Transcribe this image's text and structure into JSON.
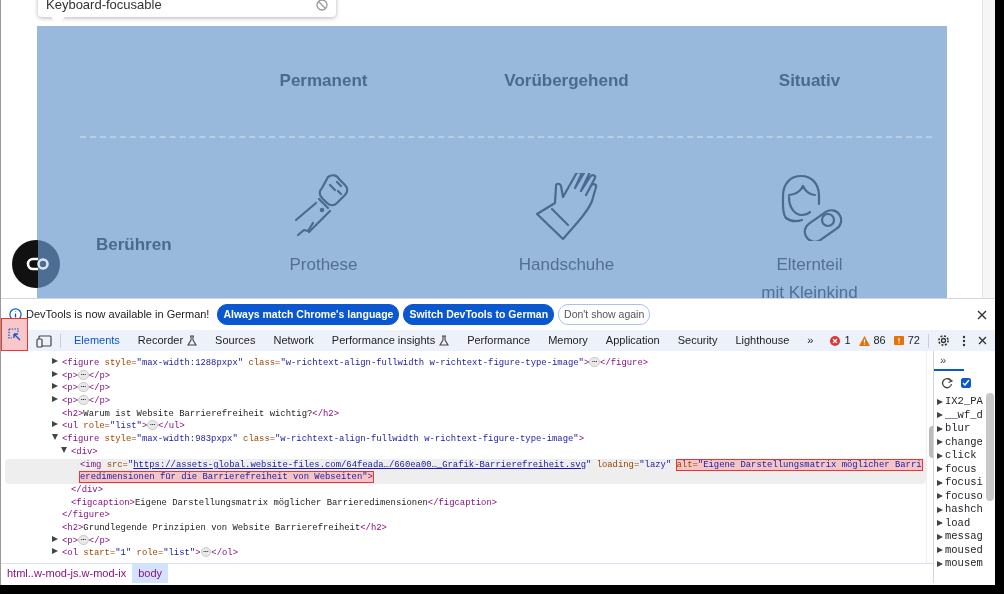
{
  "page": {
    "tooltip": {
      "text": "Keyboard-focusable"
    },
    "matrix": {
      "columns": [
        "Permanent",
        "Vorübergehend",
        "Situativ"
      ],
      "rows": [
        {
          "label": "Berühren",
          "cells": [
            {
              "kind": "prosthesis",
              "label": "Prothese"
            },
            {
              "kind": "glove",
              "label": "Handschuhe"
            },
            {
              "kind": "parent",
              "label": "Elternteil\nmit Kleinkind"
            }
          ]
        }
      ]
    }
  },
  "infobar": {
    "message": "DevTools is now available in German!",
    "buttons": [
      {
        "label": "Always match Chrome's language",
        "kind": "primary"
      },
      {
        "label": "Switch DevTools to German",
        "kind": "primary"
      },
      {
        "label": "Don't show again",
        "kind": "outline"
      }
    ]
  },
  "toolbar": {
    "inspect_selected": true,
    "tabs": [
      {
        "label": "Elements",
        "selected": true,
        "experimental": false
      },
      {
        "label": "Recorder",
        "selected": false,
        "experimental": true
      },
      {
        "label": "Sources",
        "selected": false,
        "experimental": false
      },
      {
        "label": "Network",
        "selected": false,
        "experimental": false
      },
      {
        "label": "Performance insights",
        "selected": false,
        "experimental": true
      },
      {
        "label": "Performance",
        "selected": false,
        "experimental": false
      },
      {
        "label": "Memory",
        "selected": false,
        "experimental": false
      },
      {
        "label": "Application",
        "selected": false,
        "experimental": false
      },
      {
        "label": "Security",
        "selected": false,
        "experimental": false
      },
      {
        "label": "Lighthouse",
        "selected": false,
        "experimental": false
      }
    ],
    "more": "»",
    "errors": "1",
    "warnings": "86",
    "issues": "72"
  },
  "elements": {
    "nodes": [
      {
        "expanded": false,
        "selected": false,
        "rows": [
          [
            {
              "kind": "tag",
              "t": "<figure"
            },
            {
              "kind": "attr",
              "t": " style="
            },
            {
              "kind": "val",
              "t": "\"max-width:1288pxpx\""
            },
            {
              "kind": "attr",
              "t": " class="
            },
            {
              "kind": "val",
              "t": "\"w-richtext-align-fullwidth w-richtext-figure-type-image\""
            },
            {
              "kind": "tag",
              "t": ">"
            },
            {
              "kind": "more",
              "t": "⋯"
            },
            {
              "kind": "tag",
              "t": "</figure>"
            }
          ]
        ]
      },
      {
        "expanded": false,
        "selected": false,
        "rows": [
          [
            {
              "kind": "tag",
              "t": "<p>"
            },
            {
              "kind": "more",
              "t": "⋯"
            },
            {
              "kind": "tag",
              "t": "</p>"
            }
          ]
        ]
      },
      {
        "expanded": false,
        "selected": false,
        "rows": [
          [
            {
              "kind": "tag",
              "t": "<p>"
            },
            {
              "kind": "more",
              "t": "⋯"
            },
            {
              "kind": "tag",
              "t": "</p>"
            }
          ]
        ]
      },
      {
        "expanded": false,
        "selected": false,
        "rows": [
          [
            {
              "kind": "tag",
              "t": "<p>"
            },
            {
              "kind": "more",
              "t": "⋯"
            },
            {
              "kind": "tag",
              "t": "</p>"
            }
          ]
        ]
      },
      {
        "selected": false,
        "rows": [
          [
            {
              "kind": "tag",
              "t": "<h2>"
            },
            {
              "kind": "text",
              "t": "Warum ist Website Barrierefreiheit wichtig?"
            },
            {
              "kind": "tag",
              "t": "</h2>"
            }
          ]
        ]
      },
      {
        "expanded": false,
        "selected": false,
        "rows": [
          [
            {
              "kind": "tag",
              "t": "<ul"
            },
            {
              "kind": "attr",
              "t": " role="
            },
            {
              "kind": "val",
              "t": "\"list\""
            },
            {
              "kind": "tag",
              "t": ">"
            },
            {
              "kind": "more",
              "t": "⋯"
            },
            {
              "kind": "tag",
              "t": "</ul>"
            }
          ]
        ]
      },
      {
        "expanded": true,
        "selected": false,
        "rows": [
          [
            {
              "kind": "tag",
              "t": "<figure"
            },
            {
              "kind": "attr",
              "t": " style="
            },
            {
              "kind": "val",
              "t": "\"max-width:983pxpx\""
            },
            {
              "kind": "attr",
              "t": " class="
            },
            {
              "kind": "val",
              "t": "\"w-richtext-align-fullwidth w-richtext-figure-type-image\""
            },
            {
              "kind": "tag",
              "t": ">"
            }
          ]
        ],
        "children": [
          {
            "expanded": true,
            "selected": false,
            "rows": [
              [
                {
                  "kind": "tag",
                  "t": "<div>"
                }
              ]
            ],
            "children": [
              {
                "selected": true,
                "rows": [
                  [
                    {
                      "kind": "tag",
                      "t": "<img"
                    },
                    {
                      "kind": "attr",
                      "t": " src="
                    },
                    {
                      "kind": "val",
                      "t": "\""
                    },
                    {
                      "kind": "link",
                      "t": "https://assets-global.website-files.com/64feada…/660ea00…_Grafik-Barrierefreiheit.svg"
                    },
                    {
                      "kind": "val",
                      "t": "\""
                    },
                    {
                      "kind": "attr",
                      "t": " loading="
                    },
                    {
                      "kind": "val",
                      "t": "\"lazy\" "
                    },
                    {
                      "kind": "flag",
                      "parts": [
                        {
                          "kind": "attr",
                          "t": "alt="
                        },
                        {
                          "kind": "val",
                          "t": "\"Eigene Darstellungsmatrix möglicher Barri"
                        }
                      ]
                    }
                  ],
                  [
                    {
                      "kind": "flag",
                      "parts": [
                        {
                          "kind": "val",
                          "t": "eredimensionen für die Barrierefreiheit von Webseiten\""
                        },
                        {
                          "kind": "tag",
                          "t": ">"
                        }
                      ]
                    }
                  ]
                ]
              }
            ],
            "close": [
              {
                "kind": "tag",
                "t": "</div>"
              }
            ]
          },
          {
            "selected": false,
            "rows": [
              [
                {
                  "kind": "tag",
                  "t": "<figcaption>"
                },
                {
                  "kind": "text",
                  "t": "Eigene Darstellungsmatrix möglicher Barrieredimensionen"
                },
                {
                  "kind": "tag",
                  "t": "</figcaption>"
                }
              ]
            ]
          }
        ],
        "close": [
          {
            "kind": "tag",
            "t": "</figure>"
          }
        ]
      },
      {
        "selected": false,
        "rows": [
          [
            {
              "kind": "tag",
              "t": "<h2>"
            },
            {
              "kind": "text",
              "t": "Grundlegende Prinzipien von Website Barrierefreiheit"
            },
            {
              "kind": "tag",
              "t": "</h2>"
            }
          ]
        ]
      },
      {
        "expanded": false,
        "selected": false,
        "rows": [
          [
            {
              "kind": "tag",
              "t": "<p>"
            },
            {
              "kind": "more",
              "t": "⋯"
            },
            {
              "kind": "tag",
              "t": "</p>"
            }
          ]
        ]
      },
      {
        "expanded": false,
        "selected": false,
        "rows": [
          [
            {
              "kind": "tag",
              "t": "<ol"
            },
            {
              "kind": "attr",
              "t": " start="
            },
            {
              "kind": "val",
              "t": "\"1\""
            },
            {
              "kind": "attr",
              "t": " role="
            },
            {
              "kind": "val",
              "t": "\"list\""
            },
            {
              "kind": "tag",
              "t": ">"
            },
            {
              "kind": "more",
              "t": "⋯"
            },
            {
              "kind": "tag",
              "t": "</ol>"
            }
          ]
        ]
      }
    ]
  },
  "breadcrumbs": [
    {
      "label": "html..w-mod-js.w-mod-ix",
      "selected": false
    },
    {
      "label": "body",
      "selected": true
    }
  ],
  "sidebar": {
    "more": "»",
    "checked": true,
    "listeners": [
      "IX2_PA",
      "__wf_d",
      "blur",
      "change",
      "click",
      "focus",
      "focusi",
      "focuso",
      "hashch",
      "load",
      "messag",
      "moused",
      "mousem"
    ]
  }
}
